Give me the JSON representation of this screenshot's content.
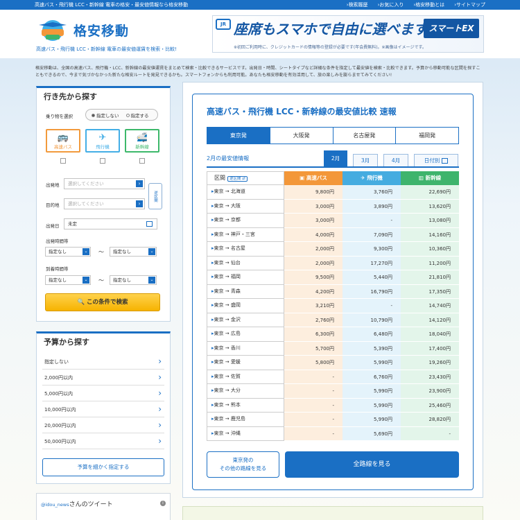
{
  "topbar": {
    "tagline": "高速バス・飛行機 LCC・新幹線 電車の格安・最安値情報なら格安移動",
    "nav": [
      "検索履歴",
      "お気に入り",
      "格安移動とは",
      "サイトマップ"
    ]
  },
  "header": {
    "logo_text": "格安移動",
    "subtitle": "高速バス・飛行機 LCC・新幹線 電車の最安値運賃を検索・比較!"
  },
  "banner": {
    "jr": "JR",
    "main": "座席もスマホで自由に選べます!",
    "brand": "スマートEX",
    "note": "※初回ご利用時に、クレジットカードの情報等の登録が必要です(年会費無料)。※画像はイメージです。"
  },
  "intro": "格安移動は、全国の高速バス、飛行機・LCC、新幹線の最安値運賃をまとめて検索・比較できるサービスです。出発日・時間、シートタイプなど詳細な条件を指定して最安値を検索・比較できます。予算から移動可能な区間を探すこともできるので、今まで気づかなかった新たな格安ルートを発見できるかも。スマートフォンからも利用可能。あなたも格安移動を有効活用して、旅の楽しみを膨らませてみてください!",
  "search": {
    "title": "行き先から探す",
    "vehicle_label": "乗り物を選択",
    "radio_none": "指定しない",
    "radio_specify": "指定する",
    "vehicles": [
      "高速バス",
      "飛行機",
      "新幹線"
    ],
    "from_label": "出発地",
    "to_label": "目的地",
    "place_placeholder": "選択してください",
    "swap": "逆区間",
    "date_label": "出発日",
    "date_value": "未定",
    "dep_time_label": "出発時間帯",
    "arr_time_label": "到着時間帯",
    "time_none": "指定なし",
    "tilde": "〜",
    "button": "この条件で検索"
  },
  "budget": {
    "title": "予算から探す",
    "items": [
      "指定しない",
      "2,000円以内",
      "5,000円以内",
      "10,000円以内",
      "20,000円以内",
      "50,000円以内"
    ],
    "detail_button": "予算を細かく指定する"
  },
  "twitter": {
    "handle": "@idou_news",
    "suffix": "さんのツイート"
  },
  "main": {
    "title": "高速バス・飛行機 LCC・新幹線の最安値比較 速報",
    "tabs": [
      "東京発",
      "大阪発",
      "名古屋発",
      "福岡発"
    ],
    "sub_heading": "2月の最安値情報",
    "month_tabs": [
      "2月",
      "3月",
      "4月",
      "日付別"
    ],
    "col_route": "区間",
    "col_swap": "逆区間",
    "col_bus": "高速バス",
    "col_plane": "飛行機",
    "col_train": "新幹線",
    "rows": [
      {
        "route": "東京 → 北海道",
        "bus": "9,800円",
        "plane": "3,760円",
        "train": "22,690円"
      },
      {
        "route": "東京 → 大阪",
        "bus": "3,000円",
        "plane": "3,890円",
        "train": "13,620円"
      },
      {
        "route": "東京 → 京都",
        "bus": "3,000円",
        "plane": "-",
        "train": "13,080円"
      },
      {
        "route": "東京 → 神戸・三宮",
        "bus": "4,000円",
        "plane": "7,090円",
        "train": "14,160円"
      },
      {
        "route": "東京 → 名古屋",
        "bus": "2,000円",
        "plane": "9,300円",
        "train": "10,360円"
      },
      {
        "route": "東京 → 仙台",
        "bus": "2,000円",
        "plane": "17,270円",
        "train": "11,200円"
      },
      {
        "route": "東京 → 福岡",
        "bus": "9,500円",
        "plane": "5,440円",
        "train": "21,810円"
      },
      {
        "route": "東京 → 青森",
        "bus": "4,200円",
        "plane": "16,790円",
        "train": "17,350円"
      },
      {
        "route": "東京 → 盛岡",
        "bus": "3,210円",
        "plane": "-",
        "train": "14,740円"
      },
      {
        "route": "東京 → 金沢",
        "bus": "2,760円",
        "plane": "10,790円",
        "train": "14,120円"
      },
      {
        "route": "東京 → 広島",
        "bus": "6,300円",
        "plane": "6,480円",
        "train": "18,040円"
      },
      {
        "route": "東京 → 香川",
        "bus": "5,700円",
        "plane": "5,390円",
        "train": "17,400円"
      },
      {
        "route": "東京 → 愛媛",
        "bus": "5,800円",
        "plane": "5,990円",
        "train": "19,260円"
      },
      {
        "route": "東京 → 佐賀",
        "bus": "-",
        "plane": "6,760円",
        "train": "23,430円"
      },
      {
        "route": "東京 → 大分",
        "bus": "-",
        "plane": "5,990円",
        "train": "23,900円"
      },
      {
        "route": "東京 → 熊本",
        "bus": "-",
        "plane": "5,990円",
        "train": "25,460円"
      },
      {
        "route": "東京 → 鹿児島",
        "bus": "-",
        "plane": "5,990円",
        "train": "28,820円"
      },
      {
        "route": "東京 → 沖縄",
        "bus": "-",
        "plane": "5,690円",
        "train": "-"
      }
    ],
    "other_routes_line1": "東京発の",
    "other_routes_line2": "その他の路線を見る",
    "all_routes": "全路線を見る"
  }
}
